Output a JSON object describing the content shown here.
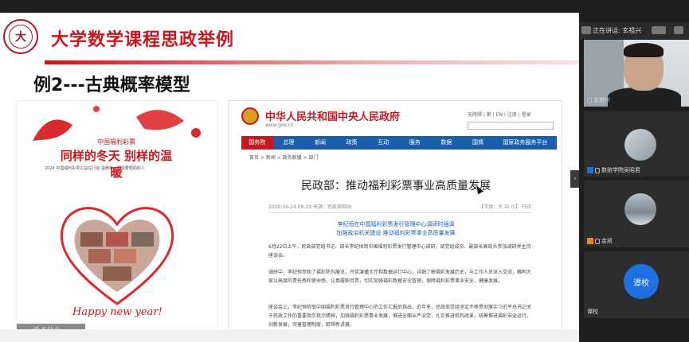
{
  "slide": {
    "title": "大学数学课程思政举例",
    "subtitle": "例2---古典概率模型",
    "logo_text": "大"
  },
  "poster": {
    "top_line": "中国福利彩票",
    "headline": "同样的冬天 别样的温暖",
    "small_text": "2024 中国福利彩票公益在行动 温暖每一个需要帮助的人",
    "new_year": "Happy new year!",
    "tag": "说点什么"
  },
  "website": {
    "site_name": "中华人民共和国中央人民政府",
    "site_url": "www.gov.cn",
    "tools": "无障碍 | 繁 | EN | 注册 | 登录",
    "nav": [
      "国务院",
      "总理",
      "新闻",
      "政策",
      "互动",
      "服务",
      "数据",
      "国情",
      "国家政务服务平台"
    ],
    "breadcrumb": "首页 > 新闻 > 政务联播 > 部门",
    "article_title": "民政部：推动福利彩票事业高质量发展",
    "meta_left": "2020-06-24 08:29   来源：民政部网站",
    "meta_right": "【字体：大 中 小】  打印",
    "lead_1": "李纪恒在中国福利彩票发行管理中心调研时强调",
    "lead_2": "加强政治机关建设  推动福利彩票事业高质量发展",
    "para_1": "6月22日上午，民政部党组书记、部长李纪恒到中国福利彩票发行管理中心调研，部党组成员、副部长高晓兵参加调研并主持座谈会。",
    "para_2": "调研中，李纪恒参观了福彩陈列展览，开奖演播大厅和数据运行中心，详细了解福彩发展历史，与工作人员深入交流，嘱咐大家以高度的责任感和使命感，认真履职尽责，切实加强福彩数据安全管理，保障福利彩票事业安全、健康发展。",
    "para_3": "座谈会上，李纪恒听取中国福利彩票发行管理中心的工作汇报后指出，近年来，民政部党组坚定不移贯彻落实习近平总书记关于民政工作的重要指示批示精神，加强福利彩票事业发展，推进全面从严治党，扎实推进机构改革，统筹推进福彩安全运行，创新发展，完善管理制度，取得新进展。"
  },
  "panel": {
    "speaking": "正在讲话: 玄祖兴",
    "tiles": [
      {
        "label": "玄祖兴"
      },
      {
        "label": "数统学院吴昭君"
      },
      {
        "label": "金凯"
      },
      {
        "label": "谭校",
        "avatar_text": "谭校"
      }
    ]
  }
}
